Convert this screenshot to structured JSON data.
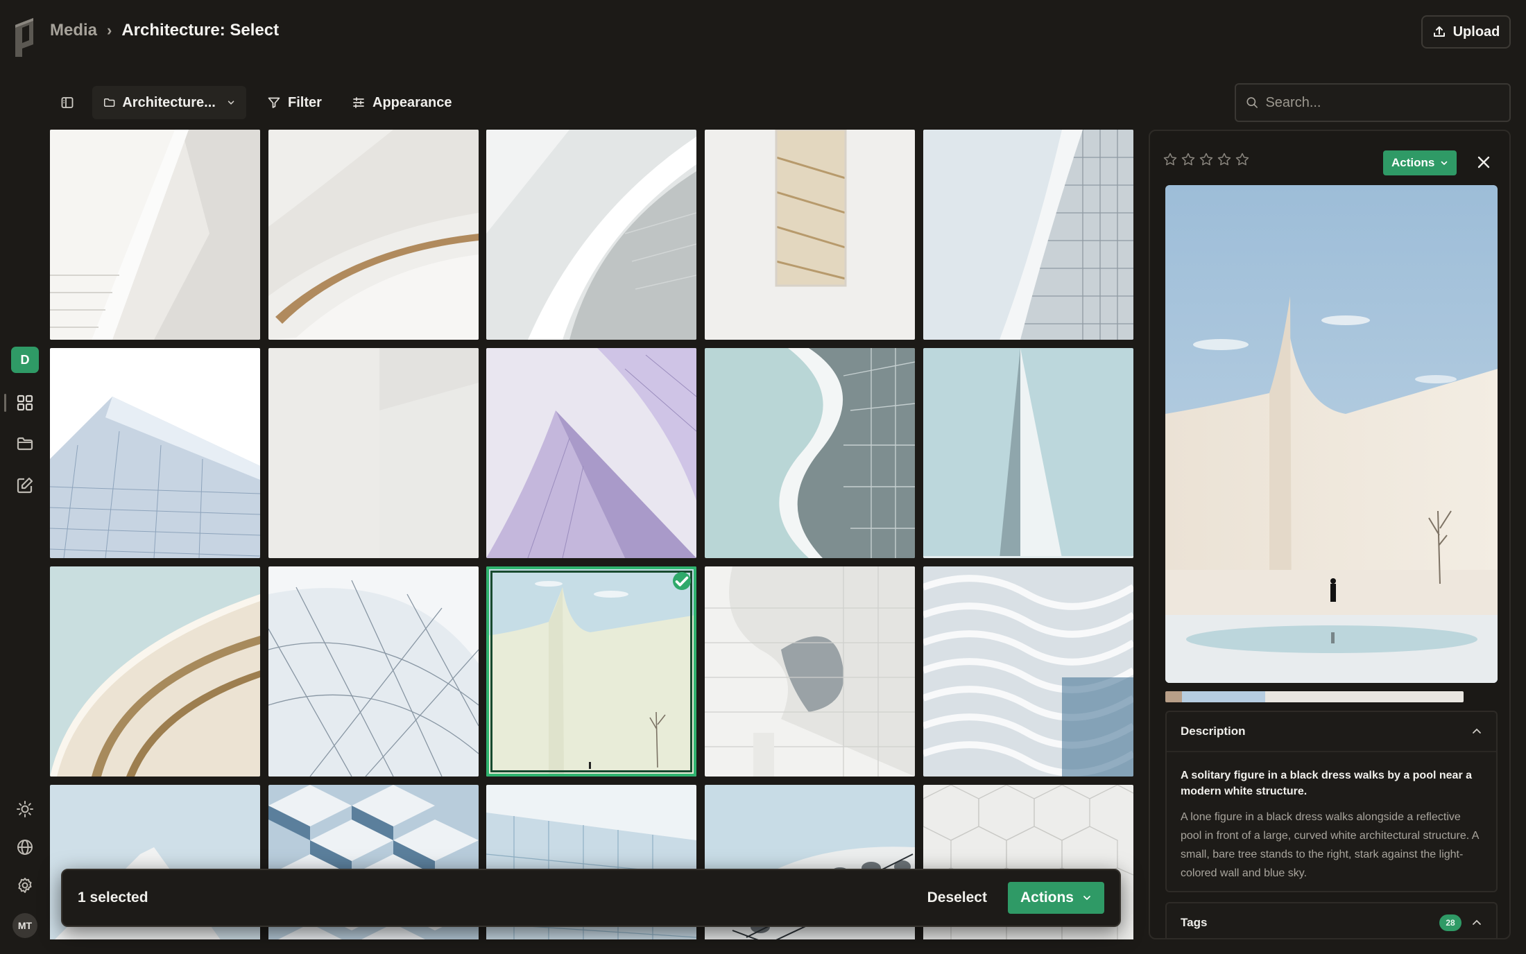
{
  "breadcrumb": {
    "root": "Media",
    "current": "Architecture: Select"
  },
  "header": {
    "upload_label": "Upload"
  },
  "sidebar": {
    "workspace_initial": "D",
    "user_initials": "MT"
  },
  "toolbar": {
    "folder_label": "Architecture...",
    "filter_label": "Filter",
    "appearance_label": "Appearance",
    "search_placeholder": "Search..."
  },
  "grid": {
    "tiles": [
      {
        "palette": "white-stairs"
      },
      {
        "palette": "spiral-wood"
      },
      {
        "palette": "white-curve"
      },
      {
        "palette": "stair-window"
      },
      {
        "palette": "tower-glass"
      },
      {
        "palette": "mesh-facade"
      },
      {
        "palette": "plain-white"
      },
      {
        "palette": "lavender-fins"
      },
      {
        "palette": "teal-wave"
      },
      {
        "palette": "spire"
      },
      {
        "palette": "gold-arcs"
      },
      {
        "palette": "glass-dome"
      },
      {
        "palette": "curved-wall",
        "selected": true
      },
      {
        "palette": "white-balconies"
      },
      {
        "palette": "blue-waves"
      },
      {
        "palette": "stepped-white"
      },
      {
        "palette": "blue-cubes"
      },
      {
        "palette": "glass-block"
      },
      {
        "palette": "perforated"
      },
      {
        "palette": "hex-tiles"
      }
    ]
  },
  "selection_bar": {
    "count_text": "1 selected",
    "deselect_label": "Deselect",
    "actions_label": "Actions"
  },
  "panel": {
    "rating": 0,
    "actions_label": "Actions",
    "palette": [
      "#b89f88",
      "#b6cde0",
      "#e9e6e0"
    ],
    "description": {
      "heading": "Description",
      "title": "A solitary figure in a black dress walks by a pool near a modern white structure.",
      "text": "A lone figure in a black dress walks alongside a reflective pool in front of a large, curved white architectural structure. A small, bare tree stands to the right, stark against the light-colored wall and blue sky."
    },
    "tags": {
      "heading": "Tags",
      "count": "28"
    }
  },
  "colors": {
    "accent": "#2f9a66",
    "background": "#1c1a17"
  }
}
